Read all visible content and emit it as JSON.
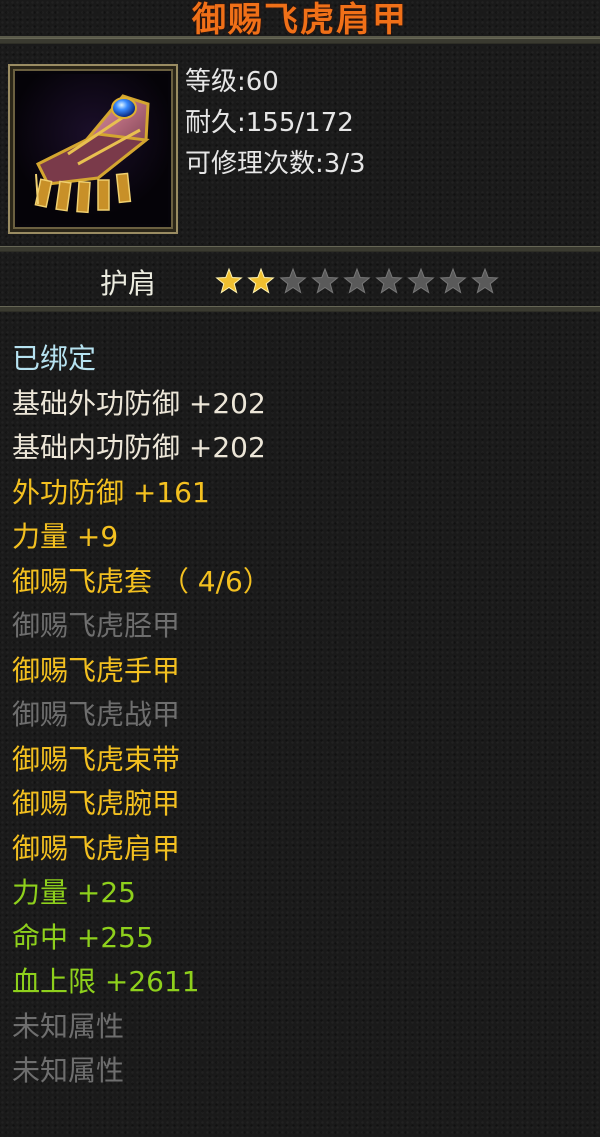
{
  "item": {
    "name": "御赐飞虎肩甲",
    "icon": "shoulder-armor-icon",
    "level": "等级:60",
    "durability": "耐久:155/172",
    "repairs": "可修理次数:3/3",
    "slot": "护肩",
    "stars": {
      "filled": 2,
      "total": 9
    }
  },
  "attributes": {
    "bound": "已绑定",
    "base_ext_def": "基础外功防御 +202",
    "base_int_def": "基础内功防御 +202",
    "ext_def": "外功防御 +161",
    "strength": "力量 +9",
    "set_name": "御赐飞虎套 （ 4/6）",
    "set_items": [
      {
        "name": "御赐飞虎胫甲",
        "equipped": false
      },
      {
        "name": "御赐飞虎手甲",
        "equipped": true
      },
      {
        "name": "御赐飞虎战甲",
        "equipped": false
      },
      {
        "name": "御赐飞虎束带",
        "equipped": true
      },
      {
        "name": "御赐飞虎腕甲",
        "equipped": true
      },
      {
        "name": "御赐飞虎肩甲",
        "equipped": true
      }
    ],
    "set_bonus": [
      "力量 +25",
      "命中 +255",
      "血上限 +2611"
    ],
    "unknown": [
      "未知属性",
      "未知属性"
    ]
  },
  "colors": {
    "title": "#f07018",
    "bound": "#b6e2f0",
    "base": "#ece6d8",
    "gold": "#f3c020",
    "inactive": "#6e6e6e",
    "bonus": "#8ed01c",
    "star_filled": "#f0c030",
    "star_empty": "#5a5a5a"
  }
}
